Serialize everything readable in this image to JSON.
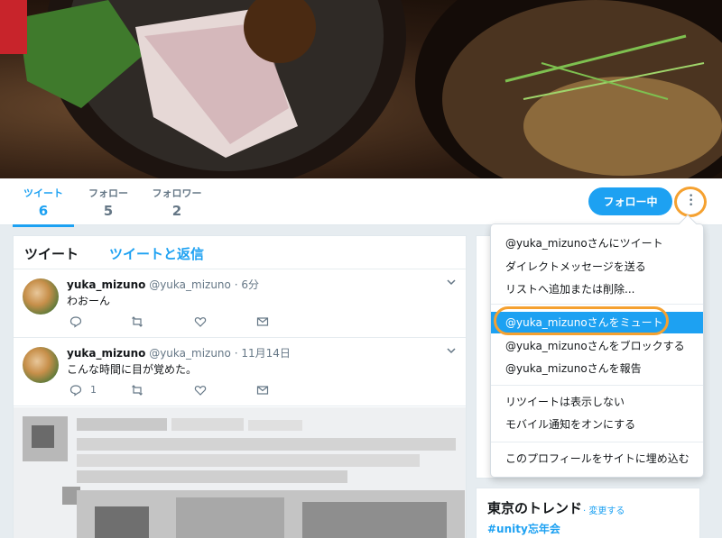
{
  "profile_nav": {
    "stats": [
      {
        "label": "ツイート",
        "value": "6"
      },
      {
        "label": "フォロー",
        "value": "5"
      },
      {
        "label": "フォロワー",
        "value": "2"
      }
    ],
    "follow_button": "フォロー中"
  },
  "timeline": {
    "tabs": [
      "ツイート",
      "ツイートと返信"
    ],
    "tweets": [
      {
        "name": "yuka_mizuno",
        "handle": "@yuka_mizuno",
        "time": "· 6分",
        "text": "わおーん",
        "reply_count": ""
      },
      {
        "name": "yuka_mizuno",
        "handle": "@yuka_mizuno",
        "time": "· 11月14日",
        "text": "こんな時間に目が覚めた。",
        "reply_count": "1"
      }
    ]
  },
  "dropdown": {
    "items": [
      "@yuka_mizunoさんにツイート",
      "ダイレクトメッセージを送る",
      "リストへ追加または削除...",
      "@yuka_mizunoさんをミュート",
      "@yuka_mizunoさんをブロックする",
      "@yuka_mizunoさんを報告",
      "リツイートは表示しない",
      "モバイル通知をオンにする",
      "このプロフィールをサイトに埋め込む"
    ],
    "selected_index": 3
  },
  "trends": {
    "title": "東京のトレンド",
    "change_link": "· 変更する",
    "items": [
      "#unity忘年会"
    ]
  },
  "colors": {
    "accent": "#1da1f2",
    "highlight": "#f5a130"
  }
}
